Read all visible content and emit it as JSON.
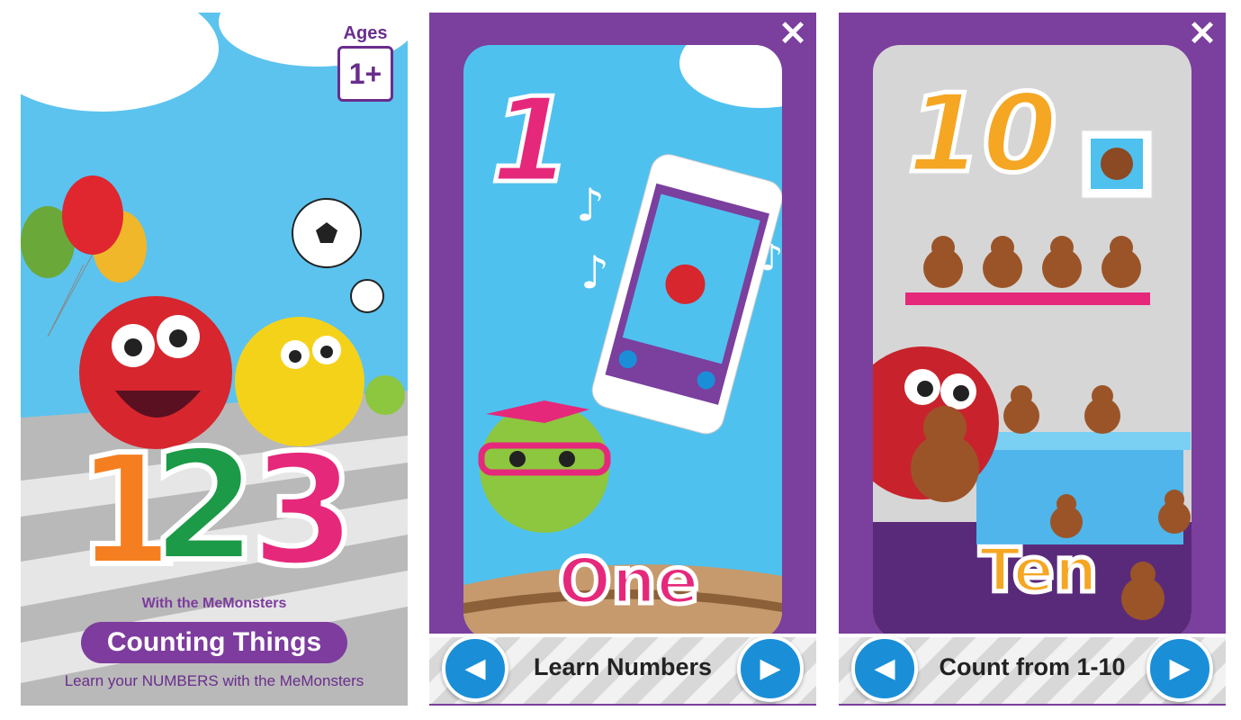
{
  "panel1": {
    "ages_label": "Ages",
    "ages_value": "1+",
    "big_numbers": [
      "1",
      "2",
      "3"
    ],
    "subtitle": "With the MeMonsters",
    "title": "Counting Things",
    "tagline": "Learn your NUMBERS with the MeMonsters"
  },
  "panel2": {
    "close": "✕",
    "number": "1",
    "word": "One",
    "bar_label": "Learn Numbers",
    "prev": "◀",
    "next": "▶"
  },
  "panel3": {
    "close": "✕",
    "number": "10",
    "word": "Ten",
    "bar_label": "Count from 1-10",
    "prev": "◀",
    "next": "▶"
  }
}
